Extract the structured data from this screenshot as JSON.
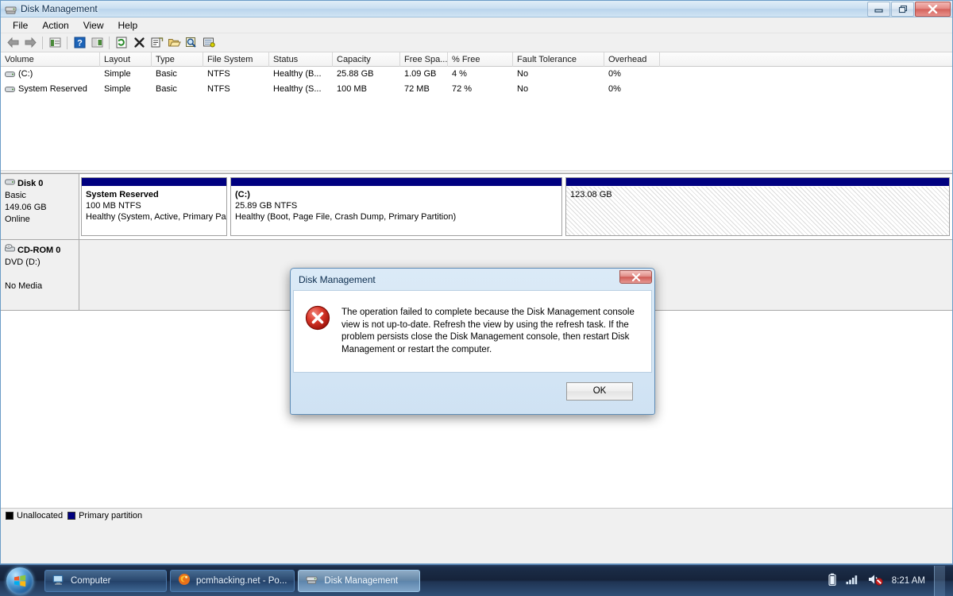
{
  "window": {
    "title": "Disk Management",
    "icon": "disk-management-icon",
    "controls": {
      "minimize": "Minimize",
      "restore": "Restore",
      "close": "Close"
    }
  },
  "menubar": {
    "items": [
      "File",
      "Action",
      "View",
      "Help"
    ]
  },
  "toolbar": {
    "buttons": [
      {
        "name": "back-icon"
      },
      {
        "name": "forward-icon"
      },
      {
        "name": "up-one-level-icon"
      },
      {
        "name": "help-icon"
      },
      {
        "name": "show-hide-console-tree-icon"
      },
      {
        "name": "refresh-icon"
      },
      {
        "name": "delete-icon"
      },
      {
        "name": "properties-icon"
      },
      {
        "name": "open-icon"
      },
      {
        "name": "search-icon"
      },
      {
        "name": "rescan-disks-icon"
      }
    ]
  },
  "volume_list": {
    "columns": [
      "Volume",
      "Layout",
      "Type",
      "File System",
      "Status",
      "Capacity",
      "Free Spa...",
      "% Free",
      "Fault Tolerance",
      "Overhead"
    ],
    "rows": [
      {
        "volume": "(C:)",
        "layout": "Simple",
        "type": "Basic",
        "file_system": "NTFS",
        "status": "Healthy (B...",
        "capacity": "25.88 GB",
        "free_space": "1.09 GB",
        "percent_free": "4 %",
        "fault_tolerance": "No",
        "overhead": "0%"
      },
      {
        "volume": "System Reserved",
        "layout": "Simple",
        "type": "Basic",
        "file_system": "NTFS",
        "status": "Healthy (S...",
        "capacity": "100 MB",
        "free_space": "72 MB",
        "percent_free": "72 %",
        "fault_tolerance": "No",
        "overhead": "0%"
      }
    ]
  },
  "graphical_view": {
    "disks": [
      {
        "name": "Disk 0",
        "type": "Basic",
        "size": "149.06 GB",
        "status": "Online",
        "partitions": [
          {
            "name": "System Reserved",
            "size": "100 MB NTFS",
            "status": "Healthy (System, Active, Primary Pa",
            "style": "primary"
          },
          {
            "name": "(C:)",
            "size": "25.89 GB NTFS",
            "status": "Healthy (Boot, Page File, Crash Dump, Primary Partition)",
            "style": "primary"
          },
          {
            "name": "123.08 GB",
            "size": "",
            "status": "",
            "style": "unallocated"
          }
        ]
      },
      {
        "name": "CD-ROM 0",
        "type": "DVD (D:)",
        "size": "",
        "status": "No Media",
        "partitions": []
      }
    ]
  },
  "legend": {
    "items": [
      {
        "label": "Unallocated",
        "color": "#000000"
      },
      {
        "label": "Primary partition",
        "color": "#000080"
      }
    ]
  },
  "dialog": {
    "title": "Disk Management",
    "icon": "error-icon",
    "message": "The operation failed to complete because the Disk Management console view is not up-to-date.  Refresh the view by using the refresh task. If the problem persists close the Disk Management console, then restart Disk Management or restart the computer.",
    "ok_label": "OK",
    "close_label": "Close"
  },
  "taskbar": {
    "start_label": "Start",
    "buttons": [
      {
        "label": "Computer",
        "icon": "computer-icon",
        "active": false
      },
      {
        "label": "pcmhacking.net - Po...",
        "icon": "firefox-icon",
        "active": false
      },
      {
        "label": "Disk Management",
        "icon": "disk-management-icon",
        "active": true
      }
    ],
    "tray": {
      "battery": "battery-icon",
      "network": "network-signal-icon",
      "volume": "volume-muted-icon",
      "clock": "8:21 AM"
    }
  },
  "colors": {
    "primary_partition": "#000080",
    "unallocated": "#000000",
    "error_red": "#cc2222",
    "titlebar": "#cfe2f3"
  }
}
